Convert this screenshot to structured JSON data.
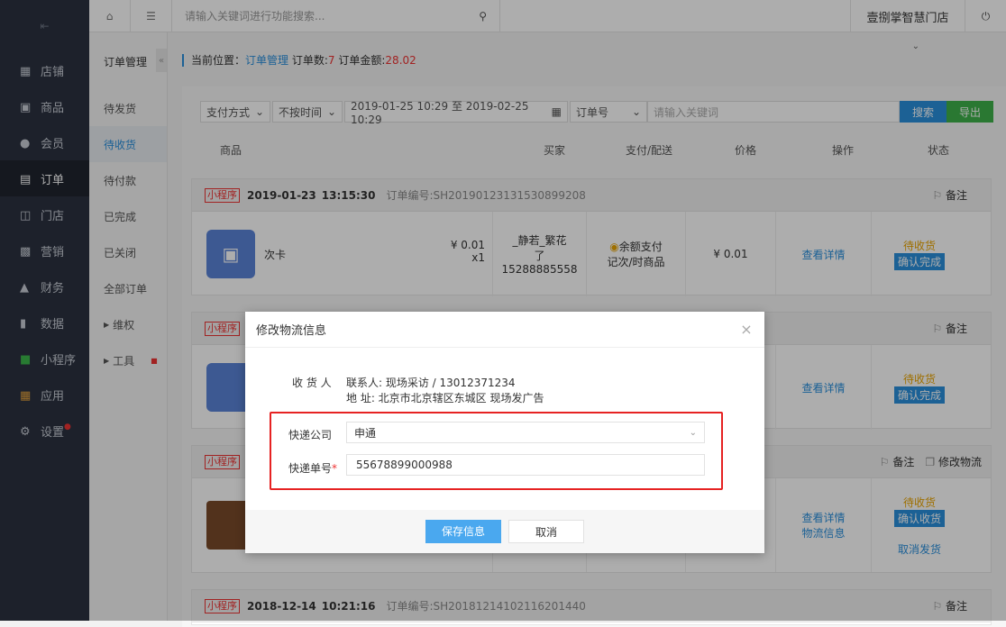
{
  "topbar": {
    "search_placeholder": "请输入关键词进行功能搜索...",
    "store": "壹捌掌智慧门店"
  },
  "sidebar": {
    "items": [
      {
        "label": "店铺"
      },
      {
        "label": "商品"
      },
      {
        "label": "会员"
      },
      {
        "label": "订单"
      },
      {
        "label": "门店"
      },
      {
        "label": "营销"
      },
      {
        "label": "财务"
      },
      {
        "label": "数据"
      },
      {
        "label": "小程序"
      },
      {
        "label": "应用"
      },
      {
        "label": "设置"
      }
    ]
  },
  "subnav": {
    "title": "订单管理",
    "items": [
      "待发货",
      "待收货",
      "待付款",
      "已完成",
      "已关闭",
      "全部订单",
      "维权",
      "工具"
    ]
  },
  "breadcrumb": {
    "prefix": "当前位置：",
    "link": "订单管理",
    "count_label": "订单数:",
    "count": "7",
    "amount_label": "订单金额:",
    "amount": "28.02"
  },
  "filters": {
    "payment": "支付方式",
    "time": "不按时间",
    "date_range": "2019-01-25 10:29 至 2019-02-25 10:29",
    "field": "订单号",
    "keyword_placeholder": "请输入关键词",
    "search": "搜索",
    "export": "导出"
  },
  "table_headers": [
    "商品",
    "买家",
    "支付/配送",
    "价格",
    "操作",
    "状态"
  ],
  "orders": [
    {
      "tag": "小程序",
      "date": "2019-01-23",
      "time": "13:15:30",
      "no_label": "订单编号:",
      "no": "SH20190123131530899208",
      "note": "备注",
      "product": "次卡",
      "unit_price": "¥ 0.01",
      "qty": "x1",
      "buyer": "_静若_繁花了",
      "phone": "15288885558",
      "pay": "余额支付",
      "ship": "记次/时商品",
      "price": "¥ 0.01",
      "detail": "查看详情",
      "status": "待收货",
      "action": "确认完成"
    },
    {
      "tag": "小程序",
      "note": "备注",
      "detail": "查看详情",
      "status": "待收货",
      "action": "确认完成"
    },
    {
      "tag": "小程序",
      "note": "备注",
      "edit": "修改物流",
      "detail": "查看详情",
      "logistics": "物流信息",
      "status": "待收货",
      "action": "确认收货",
      "cancel": "取消发货"
    },
    {
      "tag": "小程序",
      "date": "2018-12-14",
      "time": "10:21:16",
      "no_label": "订单编号:",
      "no": "SH20181214102116201440",
      "note": "备注"
    }
  ],
  "modal": {
    "title": "修改物流信息",
    "receiver_label": "收 货 人",
    "contact": "联系人: 现场采访 / 13012371234",
    "address": "地 址: 北京市北京辖区东城区 现场发广告",
    "company_label": "快递公司",
    "company": "申通",
    "tracking_label": "快递单号",
    "tracking": "55678899000988",
    "save": "保存信息",
    "cancel": "取消"
  }
}
